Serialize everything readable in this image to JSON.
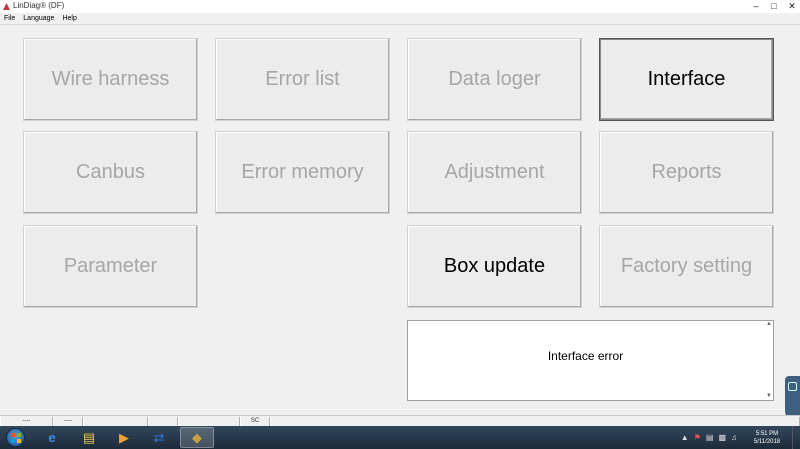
{
  "window": {
    "title": "LinDiag® (DF)",
    "minimize_glyph": "–",
    "maximize_glyph": "□",
    "close_glyph": "✕"
  },
  "menu": {
    "items": [
      "File",
      "Language",
      "Help"
    ]
  },
  "tiles": [
    {
      "label": "Wire harness",
      "enabled": false
    },
    {
      "label": "Error list",
      "enabled": false
    },
    {
      "label": "Data loger",
      "enabled": false
    },
    {
      "label": "Interface",
      "enabled": true,
      "focused": true
    },
    {
      "label": "Canbus",
      "enabled": false
    },
    {
      "label": "Error memory",
      "enabled": false
    },
    {
      "label": "Adjustment",
      "enabled": false
    },
    {
      "label": "Reports",
      "enabled": false
    },
    {
      "label": "Parameter",
      "enabled": false
    },
    {
      "label": "Box update",
      "enabled": true
    },
    {
      "label": "Factory setting",
      "enabled": false
    }
  ],
  "message": {
    "text": "Interface error"
  },
  "statusbar": {
    "cells": [
      "----",
      "----",
      "",
      "",
      "",
      "SC",
      ""
    ]
  },
  "taskbar": {
    "apps": [
      {
        "icon": "internet-explorer-icon",
        "glyph": "e",
        "color": "#3a8de0"
      },
      {
        "icon": "file-explorer-icon",
        "glyph": "▤",
        "color": "#e8c35a"
      },
      {
        "icon": "media-player-icon",
        "glyph": "▶",
        "color": "#f0a030"
      },
      {
        "icon": "teamviewer-icon",
        "glyph": "⇄",
        "color": "#2a7fd4"
      },
      {
        "icon": "lindiag-app-icon",
        "glyph": "◆",
        "color": "#c8a040",
        "active": true
      }
    ],
    "clock_time": "5:51 PM",
    "clock_date": "5/11/2018"
  },
  "colors": {
    "disabled_text": "#a6a6a6",
    "enabled_text": "#000000",
    "taskbar": "#22344a"
  }
}
